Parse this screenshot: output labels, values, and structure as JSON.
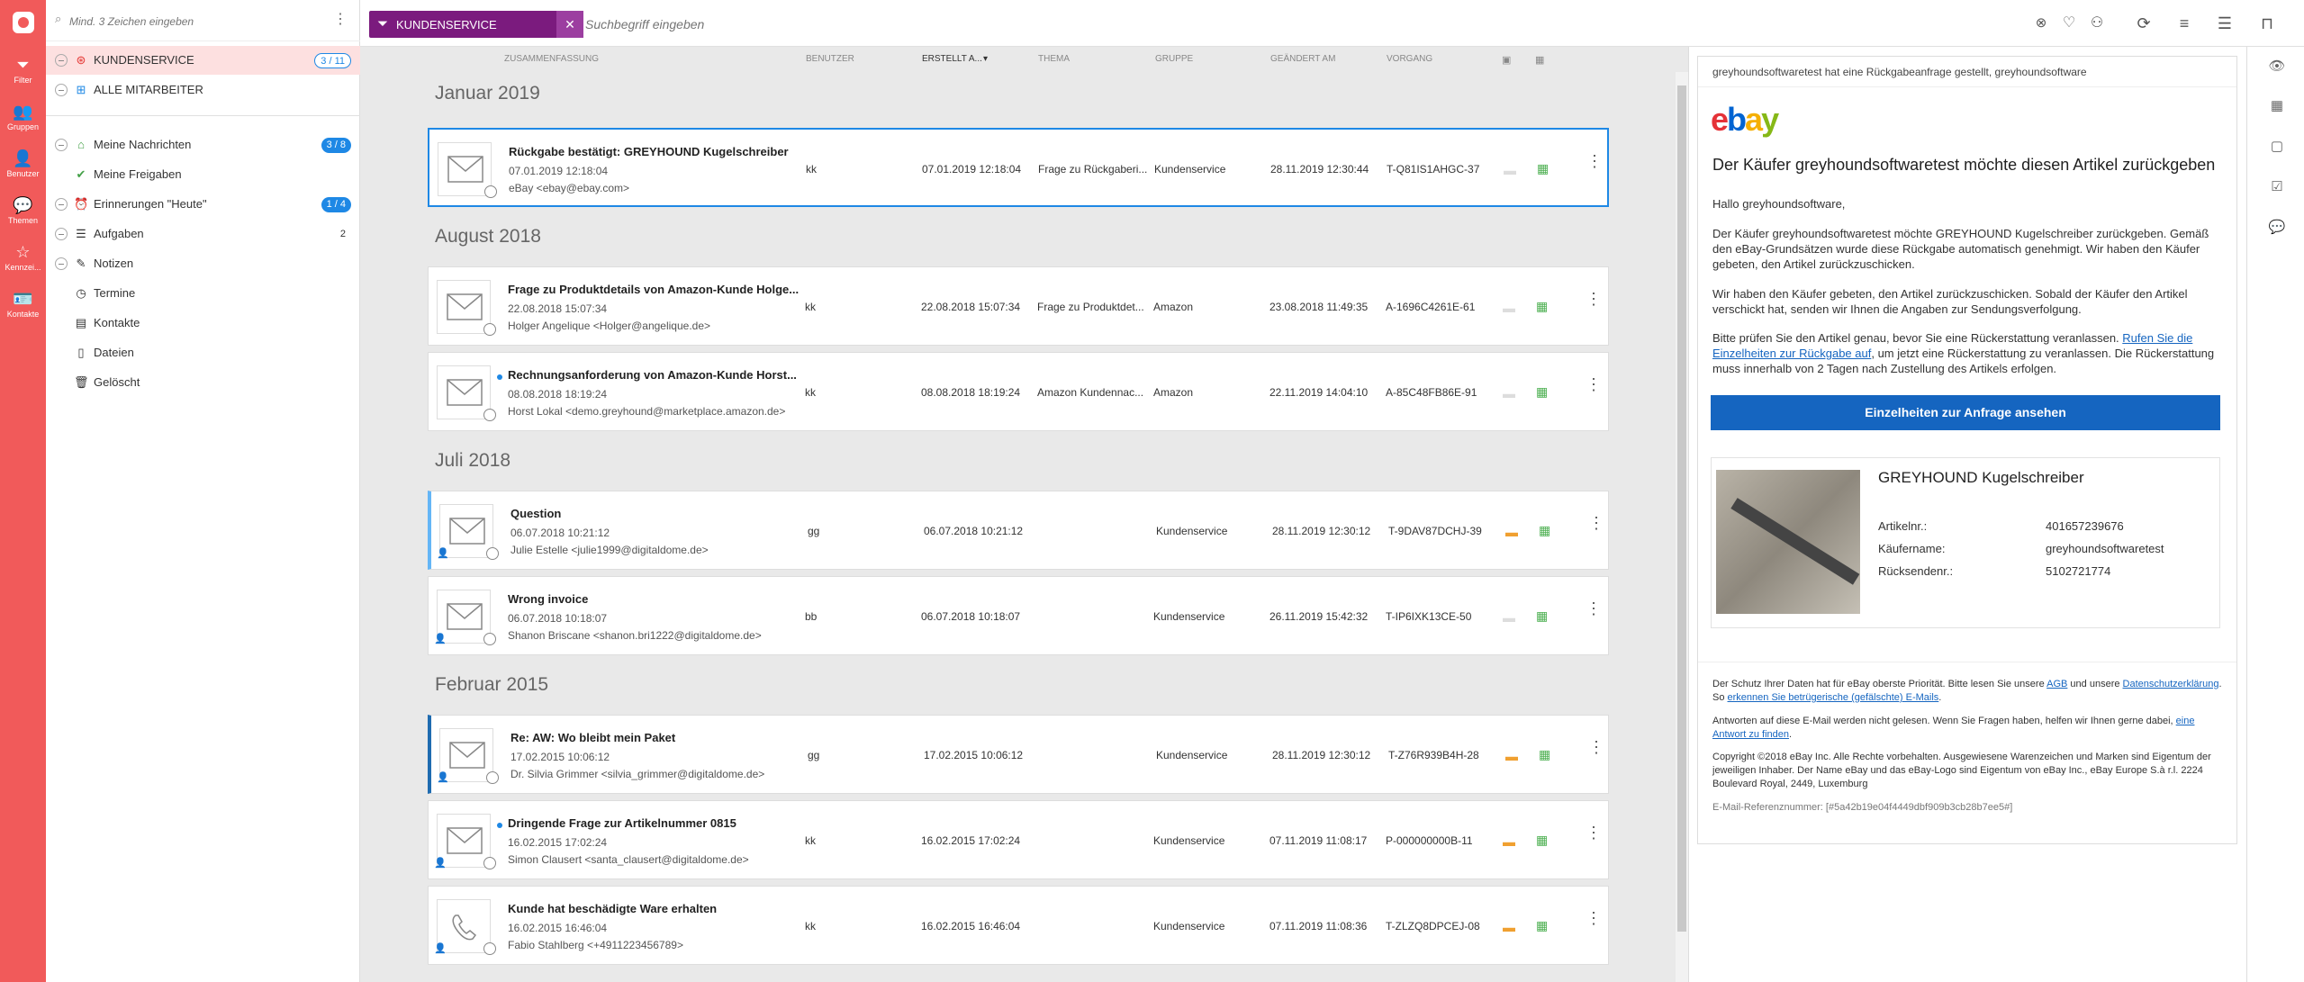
{
  "sidebar_search_placeholder": "Mind. 3 Zeichen eingeben",
  "rail": [
    {
      "label": "Filter",
      "icon": "filter-icon"
    },
    {
      "label": "Gruppen",
      "icon": "groups-icon"
    },
    {
      "label": "Benutzer",
      "icon": "user-icon"
    },
    {
      "label": "Themen",
      "icon": "topics-icon"
    },
    {
      "label": "Kennzei...",
      "icon": "star-icon"
    },
    {
      "label": "Kontakte",
      "icon": "contacts-icon"
    }
  ],
  "sidebar": {
    "kundenservice": {
      "label": "KUNDENSERVICE",
      "badge": "3 / 11"
    },
    "alle": {
      "label": "ALLE MITARBEITER"
    },
    "nachrichten": {
      "label": "Meine Nachrichten",
      "badge": "3 / 8"
    },
    "freigaben": {
      "label": "Meine Freigaben"
    },
    "erinnerungen": {
      "label": "Erinnerungen \"Heute\"",
      "badge": "1 / 4"
    },
    "aufgaben": {
      "label": "Aufgaben",
      "count": "2"
    },
    "notizen": {
      "label": "Notizen"
    },
    "termine": {
      "label": "Termine"
    },
    "kontakte": {
      "label": "Kontakte"
    },
    "dateien": {
      "label": "Dateien"
    },
    "geloescht": {
      "label": "Gelöscht"
    }
  },
  "filter_chip": "KUNDENSERVICE",
  "search_placeholder": "Suchbegriff eingeben",
  "columns": {
    "summary": "ZUSAMMENFASSUNG",
    "user": "BENUTZER",
    "created": "ERSTELLT A...",
    "topic": "THEMA",
    "group": "GRUPPE",
    "changed": "GEÄNDERT AM",
    "process": "VORGANG"
  },
  "sections": [
    "Januar 2019",
    "August 2018",
    "Juli 2018",
    "Februar 2015"
  ],
  "rows": [
    {
      "subject": "Rückgabe bestätigt: GREYHOUND Kugelschreiber",
      "date": "07.01.2019 12:18:04",
      "from": "eBay <ebay@ebay.com>",
      "user": "kk",
      "created": "07.01.2019 12:18:04",
      "topic": "Frage zu Rückgaberi...",
      "group": "Kundenservice",
      "changed": "28.11.2019 12:30:44",
      "process": "T-Q81IS1AHGC-37"
    },
    {
      "subject": "Frage zu Produktdetails von Amazon-Kunde Holge...",
      "date": "22.08.2018 15:07:34",
      "from": "Holger Angelique <Holger@angelique.de>",
      "user": "kk",
      "created": "22.08.2018 15:07:34",
      "topic": "Frage zu Produktdet...",
      "group": "Amazon",
      "changed": "23.08.2018 11:49:35",
      "process": "A-1696C4261E-61"
    },
    {
      "subject": "Rechnungsanforderung von Amazon-Kunde Horst...",
      "date": "08.08.2018 18:19:24",
      "from": "Horst Lokal <demo.greyhound@marketplace.amazon.de>",
      "user": "kk",
      "created": "08.08.2018 18:19:24",
      "topic": "Amazon Kundennac...",
      "group": "Amazon",
      "changed": "22.11.2019 14:04:10",
      "process": "A-85C48FB86E-91"
    },
    {
      "subject": "Question",
      "date": "06.07.2018 10:21:12",
      "from": "Julie Estelle <julie1999@digitaldome.de>",
      "user": "gg",
      "created": "06.07.2018 10:21:12",
      "topic": "",
      "group": "Kundenservice",
      "changed": "28.11.2019 12:30:12",
      "process": "T-9DAV87DCHJ-39"
    },
    {
      "subject": "Wrong invoice",
      "date": "06.07.2018 10:18:07",
      "from": "Shanon Briscane <shanon.bri1222@digitaldome.de>",
      "user": "bb",
      "created": "06.07.2018 10:18:07",
      "topic": "",
      "group": "Kundenservice",
      "changed": "26.11.2019 15:42:32",
      "process": "T-IP6IXK13CE-50"
    },
    {
      "subject": "Re: AW: Wo bleibt mein Paket",
      "date": "17.02.2015 10:06:12",
      "from": "Dr. Silvia Grimmer <silvia_grimmer@digitaldome.de>",
      "user": "gg",
      "created": "17.02.2015 10:06:12",
      "topic": "",
      "group": "Kundenservice",
      "changed": "28.11.2019 12:30:12",
      "process": "T-Z76R939B4H-28"
    },
    {
      "subject": "Dringende Frage zur Artikelnummer 0815",
      "date": "16.02.2015 17:02:24",
      "from": "Simon Clausert <santa_clausert@digitaldome.de>",
      "user": "kk",
      "created": "16.02.2015 17:02:24",
      "topic": "",
      "group": "Kundenservice",
      "changed": "07.11.2019 11:08:17",
      "process": "P-000000000B-11"
    },
    {
      "subject": "Kunde hat beschädigte Ware erhalten",
      "date": "16.02.2015 16:46:04",
      "from": "Fabio Stahlberg <+4911223456789>",
      "user": "kk",
      "created": "16.02.2015 16:46:04",
      "topic": "",
      "group": "Kundenservice",
      "changed": "07.11.2019 11:08:36",
      "process": "T-ZLZQ8DPCEJ-08"
    }
  ],
  "preview": {
    "title": "greyhoundsoftwaretest hat eine Rückgabeanfrage gestellt, greyhoundsoftware",
    "logo": "ebay",
    "heading": "Der Käufer greyhoundsoftwaretest möchte diesen Artikel zurückgeben",
    "greeting": "Hallo greyhoundsoftware,",
    "p1": "Der Käufer greyhoundsoftwaretest möchte GREYHOUND Kugelschreiber zurückgeben. Gemäß den eBay-Grundsätzen wurde diese Rückgabe automatisch genehmigt. Wir haben den Käufer gebeten, den Artikel zurückzuschicken.",
    "p2": "Wir haben den Käufer gebeten, den Artikel zurückzuschicken. Sobald der Käufer den Artikel verschickt hat, senden wir Ihnen die Angaben zur Sendungsverfolgung.",
    "p3a": "Bitte prüfen Sie den Artikel genau, bevor Sie eine Rückerstattung veranlassen. ",
    "p3link": "Rufen Sie die Einzelheiten zur Rückgabe auf",
    "p3b": ", um jetzt eine Rückerstattung zu veranlassen. Die Rückerstattung muss innerhalb von 2 Tagen nach Zustellung des Artikels erfolgen.",
    "button": "Einzelheiten zur Anfrage ansehen",
    "product": "GREYHOUND Kugelschreiber",
    "artikel_label": "Artikelnr.:",
    "artikel": "401657239676",
    "kaeufer_label": "Käufername:",
    "kaeufer": "greyhoundsoftwaretest",
    "ruecksende_label": "Rücksendenr.:",
    "ruecksende": "5102721774",
    "f1a": "Der Schutz Ihrer Daten hat für eBay oberste Priorität. Bitte lesen Sie unsere ",
    "f1l1": "AGB",
    "f1b": " und unsere ",
    "f1l2": "Datenschutzerklärung",
    "f1c": ". So ",
    "f1l3": "erkennen Sie betrügerische (gefälschte) E-Mails",
    "f1d": ".",
    "f2a": "Antworten auf diese E-Mail werden nicht gelesen. Wenn Sie Fragen haben, helfen wir Ihnen gerne dabei, ",
    "f2l": "eine Antwort zu finden",
    "f2b": ".",
    "f3": "Copyright ©2018 eBay Inc. Alle Rechte vorbehalten. Ausgewiesene Warenzeichen und Marken sind Eigentum der jeweiligen Inhaber. Der Name eBay und das eBay-Logo sind Eigentum von eBay Inc., eBay Europe S.à r.l. 2224 Boulevard Royal, 2449, Luxemburg",
    "f4": "E-Mail-Referenznummer: [#5a42b19e04f4449dbf909b3cb28b7ee5#]"
  },
  "colors": {
    "accent": "#f15a5a",
    "chip": "#7b1b7e",
    "blue": "#1565c0"
  }
}
